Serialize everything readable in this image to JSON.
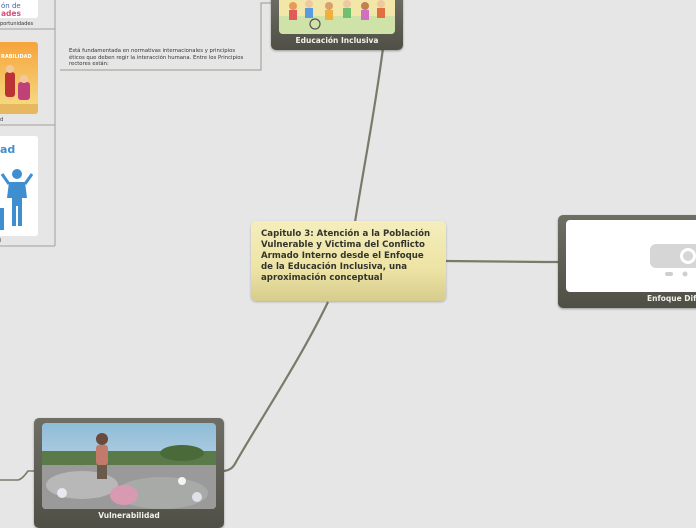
{
  "central": {
    "title": "Capitulo 3: Atención a la Población Vulnerable y Victima del Conflicto Armado Interno desde el Enfoque de la Educación Inclusiva, una aproximación conceptual"
  },
  "topics": {
    "educacion_inclusiva": "Educación Inclusiva",
    "vulnerabilidad": "Vulnerabilidad",
    "enfoque_diferencial": "Enfoque Dife"
  },
  "note": {
    "text": "Está fundamentada en normativas internacionales y principios éticos que deben regir la interacción humana. Entre los Principios rectores están:"
  },
  "left_panel": {
    "thumb1_text": "ón de\nades",
    "label1": "portunidades",
    "thumb2_text": "RABILIDAD",
    "label2": "d",
    "thumb3_text": "ad",
    "label3": "l"
  },
  "colors": {
    "background": "#e6e6e6",
    "central_fill": "#ede3a4",
    "topic_frame": "#5e5e55",
    "connector": "#7a7a6a"
  }
}
